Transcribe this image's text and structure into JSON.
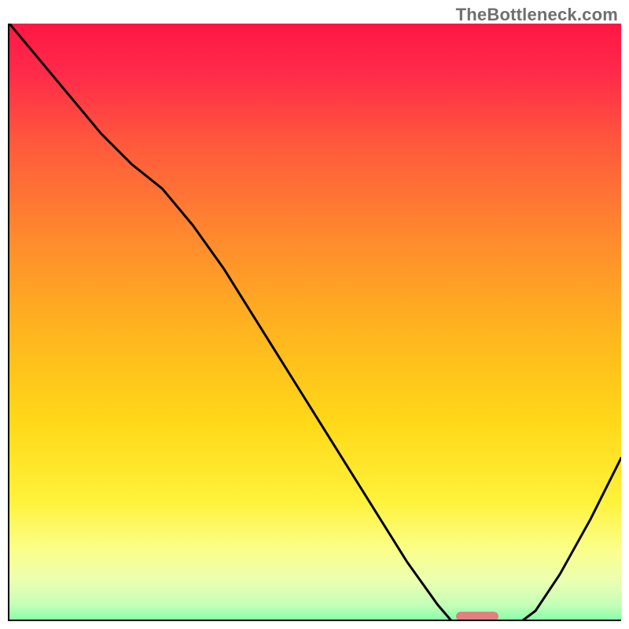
{
  "watermark": "TheBottleneck.com",
  "chart_data": {
    "type": "line",
    "title": "",
    "xlabel": "",
    "ylabel": "",
    "xlim": [
      0,
      100
    ],
    "ylim": [
      0,
      100
    ],
    "x": [
      0,
      5,
      10,
      15,
      20,
      25,
      30,
      35,
      40,
      45,
      50,
      55,
      60,
      65,
      70,
      73,
      75,
      78,
      82,
      86,
      90,
      95,
      100
    ],
    "values": [
      100,
      94,
      88,
      82,
      77,
      73,
      67,
      60,
      52,
      44,
      36,
      28,
      20,
      12,
      5,
      1.5,
      0.5,
      0.5,
      1,
      4,
      10,
      19,
      29
    ],
    "marker": {
      "x_start": 73,
      "x_end": 80,
      "y": 0.5
    },
    "gradient_stops": [
      {
        "pos": 0.0,
        "color": "#ff1744"
      },
      {
        "pos": 0.08,
        "color": "#ff2a4a"
      },
      {
        "pos": 0.2,
        "color": "#ff5a3c"
      },
      {
        "pos": 0.35,
        "color": "#ff8a2e"
      },
      {
        "pos": 0.5,
        "color": "#ffb41f"
      },
      {
        "pos": 0.65,
        "color": "#ffd818"
      },
      {
        "pos": 0.78,
        "color": "#fff23a"
      },
      {
        "pos": 0.86,
        "color": "#fbff8a"
      },
      {
        "pos": 0.91,
        "color": "#ecffb0"
      },
      {
        "pos": 0.95,
        "color": "#c4ffb8"
      },
      {
        "pos": 0.98,
        "color": "#7bffa4"
      },
      {
        "pos": 1.0,
        "color": "#28f07a"
      }
    ]
  }
}
